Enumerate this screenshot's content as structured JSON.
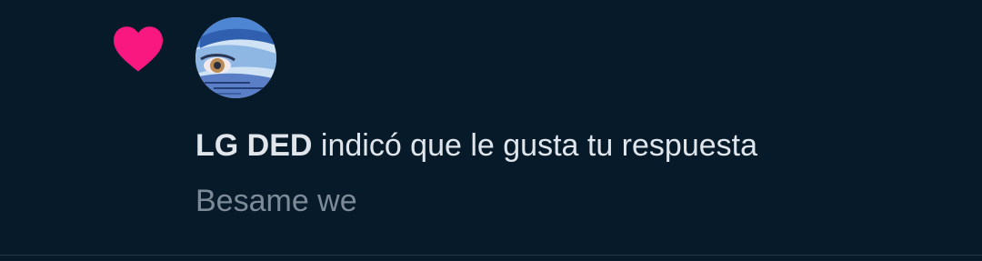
{
  "notification": {
    "type_icon": "heart-icon",
    "icon_color": "#f91880",
    "avatar_icon": "avatar",
    "user_name": "LG DED",
    "action_text": " indicó que le gusta tu respuesta",
    "reply_text": "Besame we"
  }
}
